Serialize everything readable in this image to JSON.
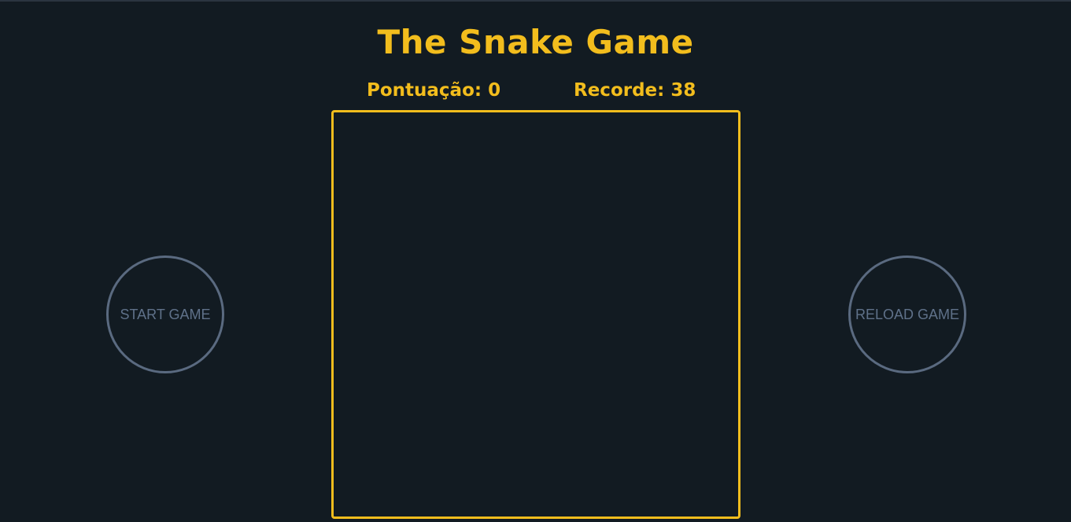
{
  "game": {
    "title": "The Snake Game",
    "score_label": "Pontuação: 0",
    "record_label": "Recorde: 38",
    "score": 0,
    "record": 38
  },
  "controls": {
    "start_label": "START GAME",
    "reload_label": "RELOAD GAME"
  },
  "colors": {
    "background": "#121b22",
    "accent": "#f2bd1d",
    "button_border": "#5a6a80",
    "button_text": "#5f7189"
  }
}
